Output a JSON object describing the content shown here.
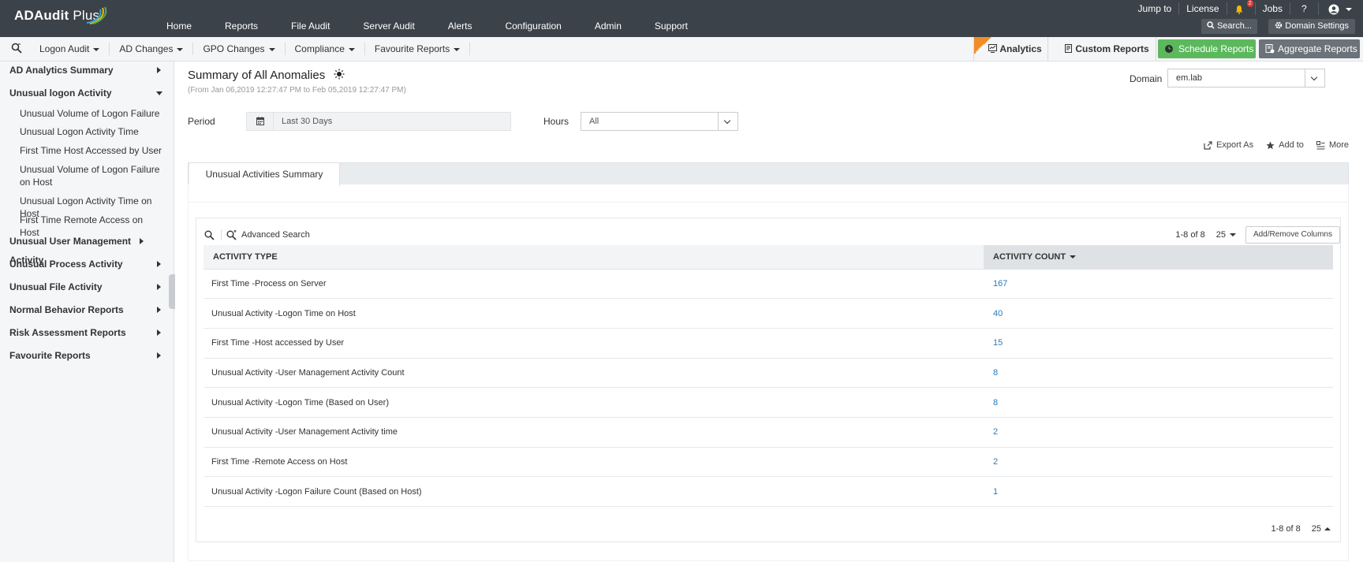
{
  "app": {
    "logo_text": "ADAudit",
    "logo_plus": " Plus"
  },
  "main_nav": [
    "Home",
    "Reports",
    "File Audit",
    "Server Audit",
    "Alerts",
    "Configuration",
    "Admin",
    "Support"
  ],
  "top_right": {
    "jump_to": "Jump to",
    "license": "License",
    "notification_count": "2",
    "jobs": "Jobs",
    "help": "?",
    "search_label": "Search...",
    "domain_settings_label": "Domain Settings"
  },
  "sub_nav": [
    "Logon Audit",
    "AD Changes",
    "GPO Changes",
    "Compliance",
    "Favourite Reports"
  ],
  "toolbar": {
    "new_tag": "NEW",
    "analytics_label": "Analytics",
    "custom_reports_label": "Custom Reports",
    "schedule_reports_label": "Schedule Reports",
    "aggregate_reports_label": "Aggregate Reports"
  },
  "sidebar": {
    "categories_top": [
      {
        "label": "AD Analytics Summary"
      },
      {
        "label": "Unusual logon Activity"
      }
    ],
    "sub_items": [
      "Unusual Volume of Logon Failure",
      "Unusual Logon Activity Time",
      "First Time Host Accessed by User",
      "Unusual Volume of Logon Failure on Host",
      "Unusual Logon Activity Time on Host",
      "First Time Remote Access on Host"
    ],
    "categories_bottom": [
      "Unusual User Management Activity",
      "Unusual Process Activity",
      "Unusual File Activity",
      "Normal Behavior Reports",
      "Risk Assessment Reports",
      "Favourite Reports"
    ]
  },
  "page": {
    "title": "Summary of All Anomalies",
    "subtitle": "(From Jan 06,2019 12:27:47 PM to Feb 05,2019 12:27:47 PM)",
    "domain_label": "Domain",
    "domain_value": "em.lab",
    "period_label": "Period",
    "period_value": "Last 30 Days",
    "hours_label": "Hours",
    "hours_value": "All",
    "export_as": "Export As",
    "add_to": "Add to",
    "more": "More",
    "tab_label": "Unusual Activities Summary"
  },
  "grid": {
    "advanced_search": "Advanced Search",
    "pager_text": "1-8 of 8",
    "page_size": "25",
    "add_remove_columns": "Add/Remove Columns",
    "columns": [
      "ACTIVITY TYPE",
      "ACTIVITY COUNT"
    ],
    "rows": [
      {
        "type": "First Time -Process on Server",
        "count": "167"
      },
      {
        "type": "Unusual Activity -Logon Time on Host",
        "count": "40"
      },
      {
        "type": "First Time -Host accessed by User",
        "count": "15"
      },
      {
        "type": "Unusual Activity -User Management Activity Count",
        "count": "8"
      },
      {
        "type": "Unusual Activity -Logon Time (Based on User)",
        "count": "8"
      },
      {
        "type": "Unusual Activity -User Management Activity time",
        "count": "2"
      },
      {
        "type": "First Time -Remote Access on Host",
        "count": "2"
      },
      {
        "type": "Unusual Activity -Logon Failure Count (Based on Host)",
        "count": "1"
      }
    ]
  },
  "colors": {
    "topbar": "#3c4249",
    "schedule_green": "#5cb85c",
    "link_blue": "#2a7ab8",
    "new_orange": "#f28c28"
  }
}
